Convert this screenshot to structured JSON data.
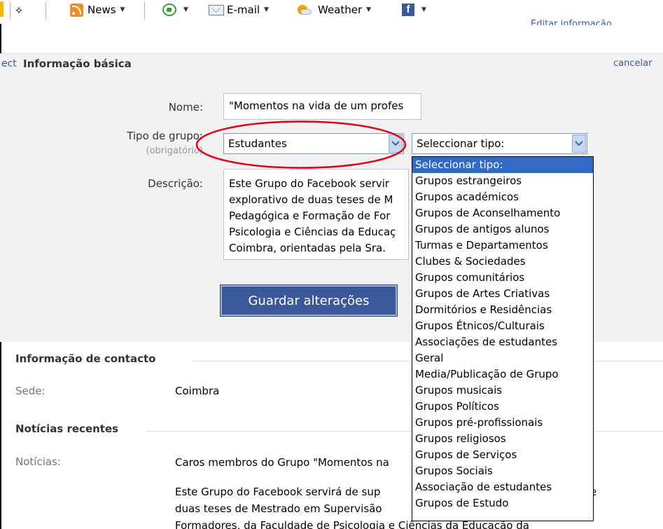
{
  "toolbar": {
    "news_label": "News",
    "email_label": "E-mail",
    "weather_label": "Weather",
    "top_right_link": "Editar informação"
  },
  "basic_info": {
    "select_fragment": "ect",
    "title": "Informação básica",
    "cancel_label": "cancelar",
    "name_label": "Nome:",
    "name_value": "\"Momentos na vida de um profes",
    "group_type_label": "Tipo de grupo:",
    "group_type_required": "(obrigatório)",
    "group_type_value": "Estudantes",
    "subtype_value": "Seleccionar tipo:",
    "description_label": "Descrição:",
    "description_lines": [
      "Este Grupo do Facebook servir",
      "explorativo de duas teses de M",
      "Pedagógica e Formação de For",
      "Psicologia e Ciências da Educaç",
      "Coimbra, orientadas pela Sra."
    ],
    "save_button": "Guardar alterações"
  },
  "subtype_options": [
    "Seleccionar tipo:",
    "Grupos estrangeiros",
    "Grupos académicos",
    "Grupos de Aconselhamento",
    "Grupos de antigos alunos",
    "Turmas e Departamentos",
    "Clubes & Sociedades",
    "Grupos comunitários",
    "Grupos de Artes Criativas",
    "Dormitórios e Residências",
    "Grupos Étnicos/Culturais",
    "Associações de estudantes",
    "Geral",
    "Media/Publicação de Grupo",
    "Grupos musicais",
    "Grupos Políticos",
    "Grupos pré-profissionais",
    "Grupos religiosos",
    "Grupos de Serviços",
    "Grupos Sociais",
    "Associação de estudantes",
    "Grupos de Estudo"
  ],
  "contact": {
    "title": "Informação de contacto",
    "seat_label": "Sede:",
    "seat_value": "Coimbra"
  },
  "news": {
    "title": "Notícias recentes",
    "label": "Notícias:",
    "line1": "Caros membros do Grupo \"Momentos na",
    "line2": "Este Grupo do Facebook servirá de sup",
    "line2_tail": "e",
    "line3": "duas teses de Mestrado em Supervisão",
    "line4": "Formadores, da Faculdade de Psicologia e Ciências da Educação da"
  },
  "colors": {
    "facebook_blue": "#3b5998",
    "selection_blue": "#316ac5",
    "annotation_red": "#e0001b"
  }
}
